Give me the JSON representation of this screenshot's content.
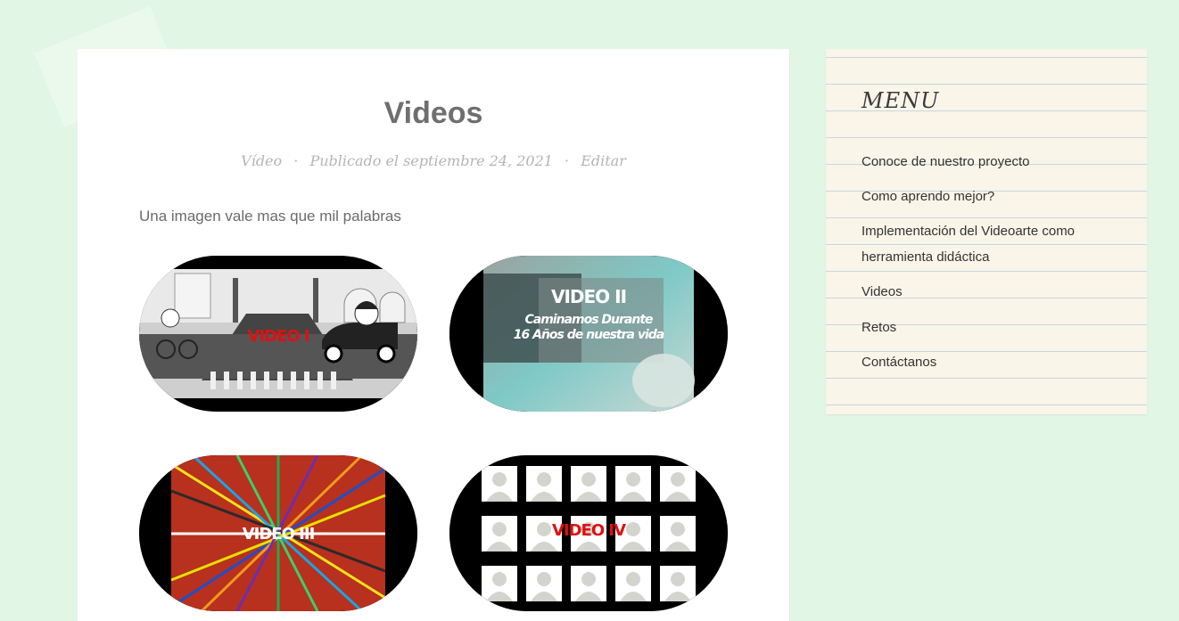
{
  "post": {
    "title": "Videos",
    "category": "Vídeo",
    "published": "Publicado el septiembre 24, 2021",
    "edit_label": "Editar",
    "meta_separator": "·",
    "intro": "Una imagen vale mas que mil palabras"
  },
  "videos": [
    {
      "label": "VIDEO I",
      "label_color": "#e01010"
    },
    {
      "label": "VIDEO II",
      "subtitle_1": "Caminamos Durante",
      "subtitle_2": "16 Años de nuestra vida",
      "label_color": "#ffffff"
    },
    {
      "label": "VIDEO III",
      "label_color": "#ffffff"
    },
    {
      "label": "VIDEO IV",
      "label_color": "#e01010"
    }
  ],
  "sidebar": {
    "title": "MENU",
    "items": [
      {
        "label": "Conoce de nuestro proyecto"
      },
      {
        "label": "Como aprendo mejor?"
      },
      {
        "label": "Implementación del Videoarte como herramienta didáctica"
      },
      {
        "label": "Videos"
      },
      {
        "label": "Retos"
      },
      {
        "label": "Contáctanos"
      }
    ]
  },
  "colors": {
    "page_background": "#e1f6e4",
    "sidebar_background": "#f9f5e8",
    "title_color": "#6f6f6f"
  }
}
